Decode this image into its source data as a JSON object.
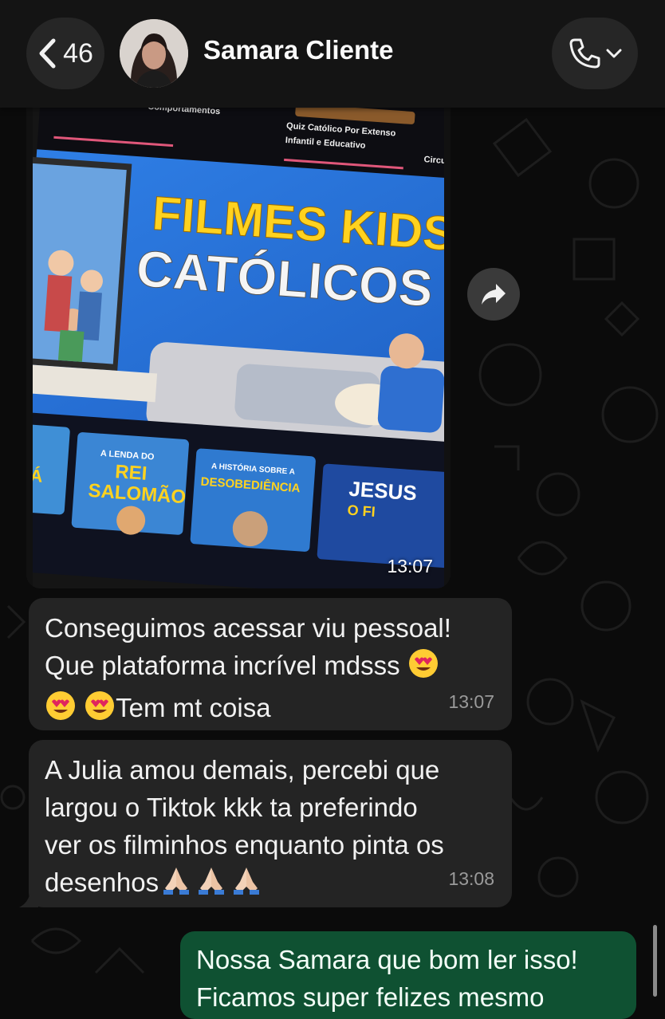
{
  "header": {
    "back_count": "46",
    "contact_name": "Samara Cliente",
    "colors": {
      "bar": "#141414",
      "pill": "#262626"
    }
  },
  "image_message": {
    "time": "13:07",
    "poster_lines": [
      "FILMES KIDS",
      "CATÓLICOS"
    ],
    "top_strip_labels": [
      "Comportamentos",
      "Quiz Católico Por Extenso",
      "Infantil e Educativo",
      "Circul"
    ],
    "thumbnails": [
      {
        "line1": "O",
        "line2": "DÁ"
      },
      {
        "line1": "A LENDA DO",
        "line2": "REI",
        "line3": "SALOMÃO"
      },
      {
        "line1": "A HISTÓRIA SOBRE A",
        "line2": "DESOBEDIÊNCIA"
      },
      {
        "line1": "JESUS",
        "line2": "O FI"
      }
    ]
  },
  "messages": [
    {
      "text": "Conseguimos acessar viu pessoal!\nQue plataforma incrível mdsss",
      "text_end": "Tem mt coisa",
      "emojis": [
        "heart-eyes",
        "heart-eyes",
        "heart-eyes"
      ],
      "time": "13:07",
      "direction": "incoming"
    },
    {
      "text": "A Julia amou demais, percebi que\nlargou o Tiktok kkk ta preferindo\nver os filminhos enquanto pinta os\ndesenhos",
      "emojis": [
        "praying-hands",
        "praying-hands",
        "praying-hands"
      ],
      "time": "13:08",
      "direction": "incoming"
    },
    {
      "text": "Nossa Samara que bom ler isso!\nFicamos super felizes mesmo",
      "direction": "outgoing"
    }
  ],
  "colors": {
    "incoming_bubble": "#242424",
    "outgoing_bubble": "#0f5132",
    "background": "#0b0b0b"
  }
}
